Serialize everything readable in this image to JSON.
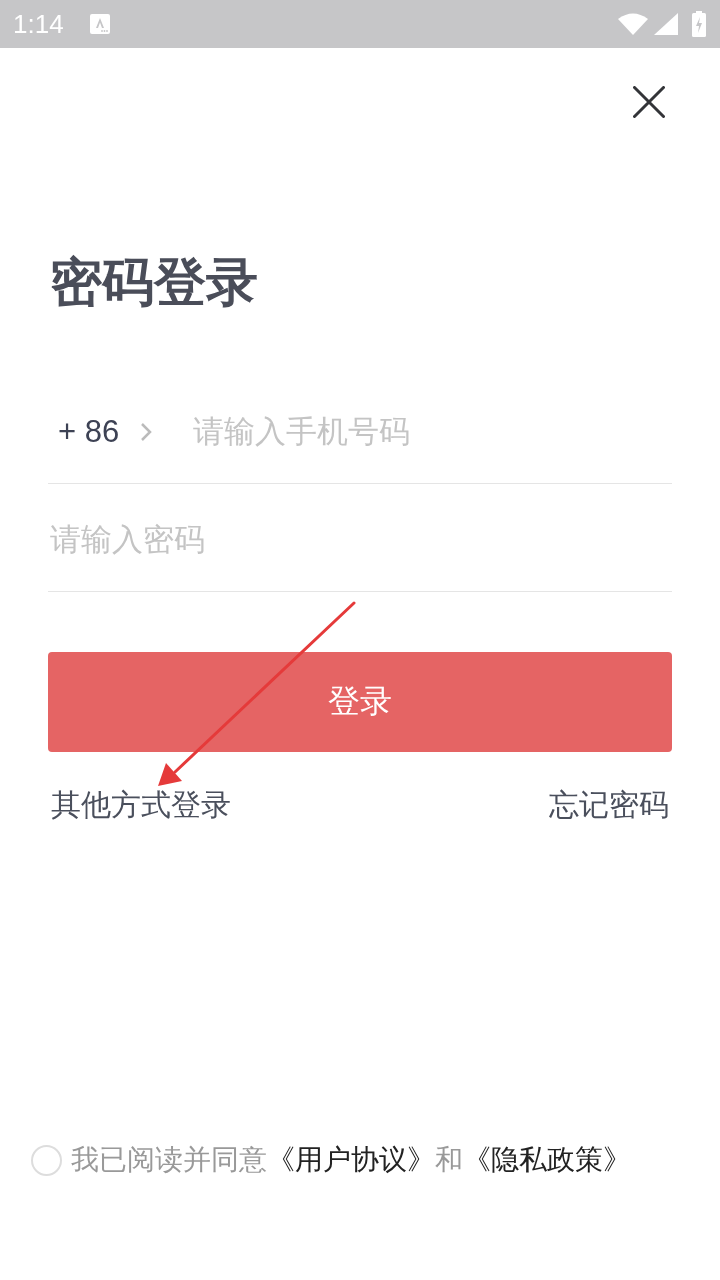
{
  "status_bar": {
    "time": "1:14"
  },
  "title": "密码登录",
  "phone": {
    "country_code": "+ 86",
    "placeholder": "请输入手机号码"
  },
  "password": {
    "placeholder": "请输入密码"
  },
  "login_button": {
    "label": "登录"
  },
  "other_login_link": "其他方式登录",
  "forgot_password_link": "忘记密码",
  "agreement": {
    "checked": false,
    "parts": [
      {
        "kind": "text",
        "text": "我已阅读并同意"
      },
      {
        "kind": "link",
        "text": "《用户协议》"
      },
      {
        "kind": "text",
        "text": "和"
      },
      {
        "kind": "link",
        "text": "《隐私政策》"
      }
    ]
  }
}
